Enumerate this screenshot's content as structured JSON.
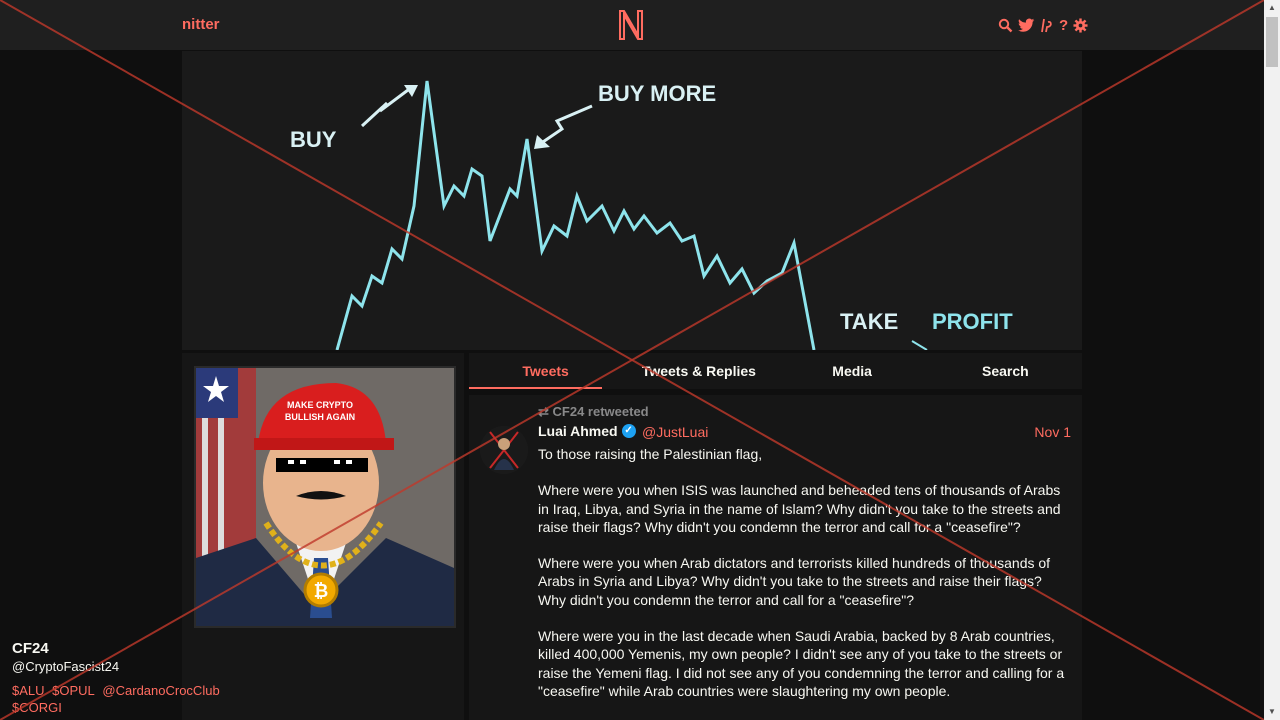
{
  "nav": {
    "brand": "nitter",
    "logo_letter": "N",
    "icons": [
      "search-icon",
      "twitter-icon",
      "pledge-icon",
      "help-icon",
      "gear-icon"
    ],
    "help_glyph": "?"
  },
  "banner": {
    "buy": "BUY",
    "buy_more": "BUY MORE",
    "take": "TAKE",
    "profit": "PROFIT"
  },
  "profile": {
    "fullname": "CF24",
    "username": "@CryptoFascist24",
    "bio_items": [
      "$ALU",
      "$OPUL",
      "@CardanoCrocClub",
      "$CORGI"
    ],
    "avatar_hat_text_1": "MAKE CRYPTO",
    "avatar_hat_text_2": "BULLISH AGAIN"
  },
  "tabs": [
    {
      "label": "Tweets",
      "active": true
    },
    {
      "label": "Tweets & Replies",
      "active": false
    },
    {
      "label": "Media",
      "active": false
    },
    {
      "label": "Search",
      "active": false
    }
  ],
  "tweet": {
    "retweet_header": "CF24 retweeted",
    "fullname": "Luai Ahmed",
    "verified_glyph": "✓",
    "username": "@JustLuai",
    "date": "Nov 1",
    "paragraphs": [
      "To those raising the Palestinian flag,",
      "Where were you when ISIS was launched and beheaded tens of thousands of Arabs in Iraq, Libya, and Syria in the name of Islam? Why didn't you take to the streets and raise their flags? Why didn't you condemn the terror and call for a \"ceasefire\"?",
      "Where were you when Arab dictators and terrorists killed hundreds of thousands of Arabs in Syria and Libya? Why didn't you take to the streets and raise their flags? Why didn't you condemn the terror and call for a \"ceasefire\"?",
      "Where were you in the last decade when Saudi Arabia, backed by 8 Arab countries, killed 400,000 Yemenis, my own people? I didn't see any of you take to the streets or raise the Yemeni flag. I did not see any of you condemning the terror and calling for a \"ceasefire\" while Arab countries were slaughtering my own people."
    ]
  },
  "colors": {
    "accent": "#ff6c60",
    "bg": "#0f0f0f",
    "panel": "#161616",
    "nav": "#1f1f1f",
    "chart_line": "#8ee4ec",
    "overlay_x": "#c0392b"
  }
}
